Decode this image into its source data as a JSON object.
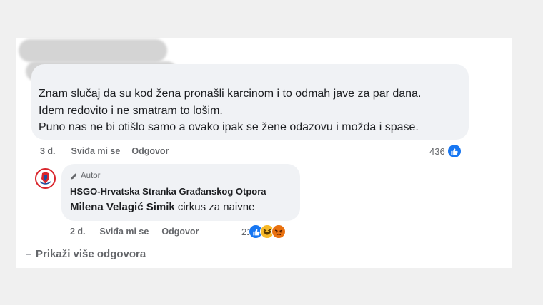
{
  "comment": {
    "lines": [
      "Znam slučaj da su kod žena pronašli karcinom i to odmah jave za par dana.",
      "Idem redovito i ne smatram to lošim.",
      "Puno nas ne bi otišlo samo a ovako ipak se žene odazovu i možda i spase."
    ],
    "time": "3 d.",
    "like_label": "Sviđa mi se",
    "reply_label": "Odgovor",
    "reaction_count": "436",
    "reaction_icons": [
      "like-icon"
    ]
  },
  "reply": {
    "author_badge": "Autor",
    "page_name": "HSGO-Hrvatska Stranka Građanskog Otpora",
    "mention": "Milena Velagić Simik",
    "text": " cirkus za naivne",
    "time": "2 d.",
    "like_label": "Sviđa mi se",
    "reply_label": "Odgovor",
    "reaction_count": "21",
    "reaction_icons": [
      "like-icon",
      "haha-icon",
      "angry-icon"
    ]
  },
  "more_replies": "Prikaži više odgovora",
  "colors": {
    "like": "#1877f2",
    "haha": "#f7b928",
    "angry": "#e9710f",
    "bubble": "#f0f2f5",
    "meta": "#65676b"
  }
}
